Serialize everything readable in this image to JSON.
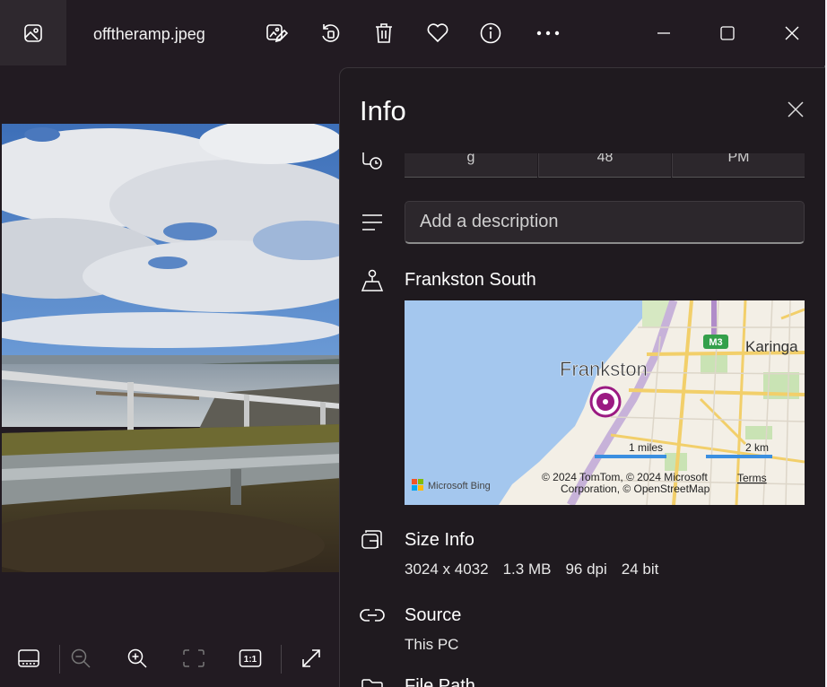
{
  "titlebar": {
    "file_name": "offtheramp.jpeg",
    "icons": [
      "gallery-icon",
      "edit-image-icon",
      "rotate-icon",
      "delete-icon",
      "favorite-icon",
      "info-icon",
      "more-icon"
    ],
    "window_controls": [
      "minimize-icon",
      "maximize-icon",
      "close-icon"
    ]
  },
  "bottom_toolbar": {
    "icons": [
      "filmstrip-icon",
      "zoom-out-icon",
      "zoom-in-icon",
      "fit-to-window-icon",
      "actual-size-icon",
      "fullscreen-icon"
    ],
    "actual_size_label": "1:1"
  },
  "info_panel": {
    "title": "Info",
    "date_time": {
      "segments": [
        "g",
        "48",
        "PM"
      ]
    },
    "description": {
      "placeholder": "Add a description",
      "value": ""
    },
    "location": {
      "name": "Frankston South",
      "map": {
        "city_label": "Frankston",
        "suburb_label": "Karinga",
        "road_shield": "M3",
        "scale_miles": "1 miles",
        "scale_km": "2 km",
        "provider": "Microsoft Bing",
        "attribution_line1": "© 2024 TomTom, © 2024 Microsoft",
        "attribution_line2": "Corporation, © OpenStreetMap",
        "terms": "Terms"
      }
    },
    "size_info": {
      "title": "Size Info",
      "dimensions": "3024 x 4032",
      "file_size": "1.3 MB",
      "dpi": "96 dpi",
      "bit_depth": "24 bit"
    },
    "source": {
      "title": "Source",
      "value": "This PC"
    },
    "file_path": {
      "title": "File Path"
    }
  },
  "colors": {
    "window_bg": "#221b22",
    "panel_bg": "#1f1a1f",
    "map_water": "#a4c7ee",
    "map_land": "#f3efe6",
    "map_pin": "#9b1a82",
    "scale_bar": "#3b8fe0"
  }
}
